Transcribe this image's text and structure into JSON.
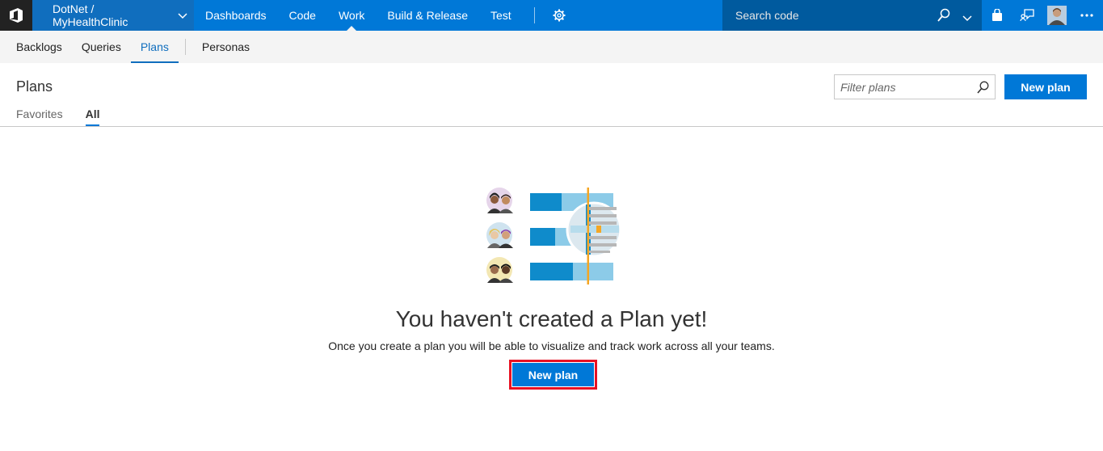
{
  "topbar": {
    "project": "DotNet / MyHealthClinic",
    "nav": [
      "Dashboards",
      "Code",
      "Work",
      "Build & Release",
      "Test"
    ],
    "active_nav": "Work",
    "search_placeholder": "Search code",
    "icons": [
      "vsts-logo-icon",
      "chevron-down-icon",
      "gear-icon",
      "search-icon",
      "marketplace-bag-icon",
      "feedback-icon",
      "user-avatar",
      "more-icon"
    ]
  },
  "subnav": {
    "items": [
      "Backlogs",
      "Queries",
      "Plans",
      "Personas"
    ],
    "active": "Plans"
  },
  "page": {
    "title": "Plans",
    "pivots": [
      "Favorites",
      "All"
    ],
    "active_pivot": "All",
    "filter_placeholder": "Filter plans",
    "new_plan_label": "New plan"
  },
  "empty_state": {
    "title": "You haven't created a Plan yet!",
    "description": "Once you create a plan you will be able to visualize and track work across all your teams.",
    "button_label": "New plan",
    "highlight_color": "#e81123"
  },
  "colors": {
    "brand_blue": "#0078d7",
    "project_blue": "#106ebe",
    "search_blue": "#005a9e"
  }
}
